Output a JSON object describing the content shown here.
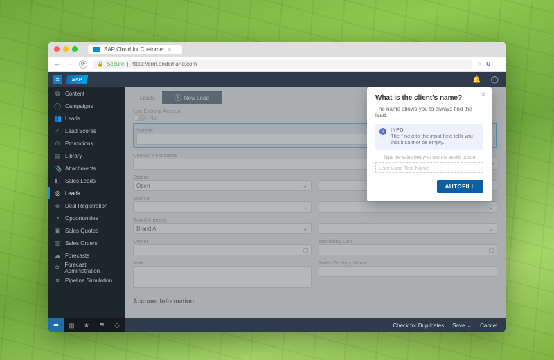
{
  "browser": {
    "tab_title": "SAP Cloud for Customer",
    "secure_label": "Secure",
    "url": "https://crm.ondemand.com"
  },
  "sidebar": {
    "items": [
      {
        "icon": "⧉",
        "label": "Content"
      },
      {
        "icon": "◯",
        "label": "Campaigns"
      },
      {
        "icon": "👥",
        "label": "Leads"
      },
      {
        "icon": "✓",
        "label": "Lead Scores"
      },
      {
        "icon": "⊙",
        "label": "Promotions"
      },
      {
        "icon": "▤",
        "label": "Library"
      },
      {
        "icon": "📎",
        "label": "Attachments"
      },
      {
        "icon": "◧",
        "label": "Sales Leads"
      },
      {
        "icon": "◎",
        "label": "Leads"
      },
      {
        "icon": "◈",
        "label": "Deal Registration"
      },
      {
        "icon": "◔",
        "label": "Opportunities"
      },
      {
        "icon": "▣",
        "label": "Sales Quotes"
      },
      {
        "icon": "▥",
        "label": "Sales Orders"
      },
      {
        "icon": "☁",
        "label": "Forecasts"
      },
      {
        "icon": "⚲",
        "label": "Forecast Administration"
      },
      {
        "icon": "≡",
        "label": "Pipeline Simulation"
      }
    ],
    "active_index": 8
  },
  "breadcrumb": {
    "parent": "Leads",
    "new_label": "New Lead"
  },
  "form": {
    "use_existing_label": "Use Existing Account",
    "use_existing_value": "No",
    "name_label": "Name",
    "contact_first_label": "Contact First Name",
    "status_label": "Status",
    "status_value": "Open",
    "source_label": "Source",
    "brand_interest_label": "Brand Interest",
    "brand_interest_value": "Brand A",
    "owner_label": "Owner",
    "marketing_unit_label": "Marketing Unit",
    "note_label": "Note",
    "sales_territory_label": "Sales Territory Name",
    "section_account": "Account Information"
  },
  "bottombar": {
    "check_duplicates": "Check for Duplicates",
    "save": "Save",
    "cancel": "Cancel"
  },
  "popover": {
    "title": "What is the client's name?",
    "subtitle": "The name allows you to always find the lead.",
    "info_label": "INFO",
    "info_text": "The * next to the input field tells you that it cannot be empty.",
    "hint": "Type the value below or use the autofill button",
    "placeholder": "User Lane  Test  Name",
    "autofill": "AUTOFILL"
  }
}
